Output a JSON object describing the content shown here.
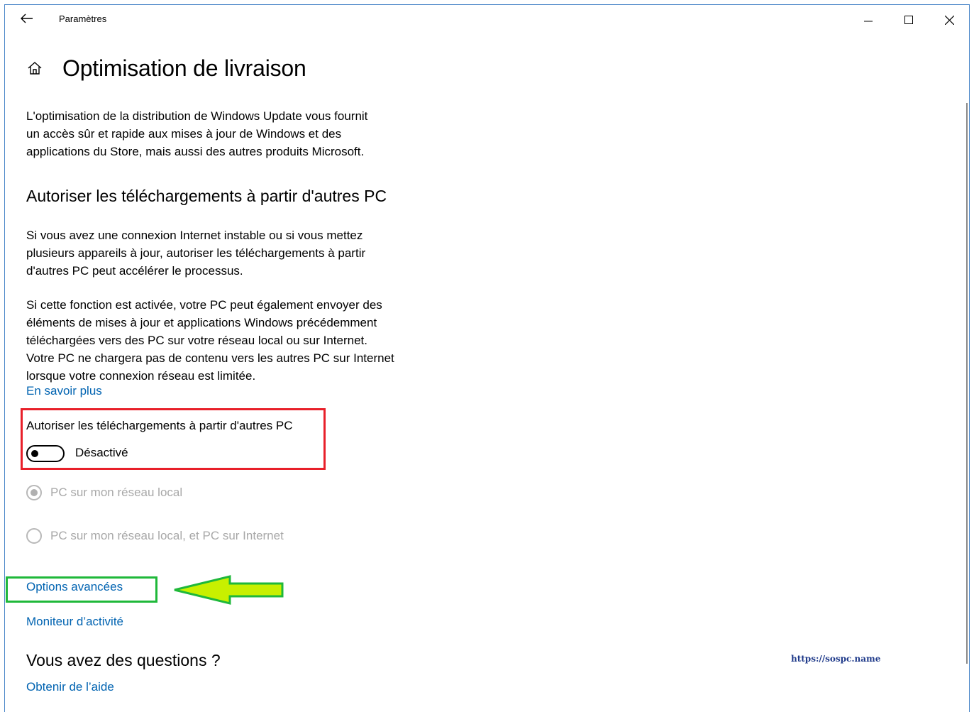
{
  "window": {
    "app_title": "Paramètres",
    "buttons": [
      "minimize-icon",
      "maximize-icon",
      "close-icon"
    ]
  },
  "page": {
    "title": "Optimisation de livraison",
    "intro_lines": [
      "L'optimisation de la distribution de Windows Update vous fournit",
      "un accès sûr et rapide aux mises à jour de Windows et des",
      "applications du Store, mais aussi des autres produits Microsoft."
    ],
    "section_heading": "Autoriser les téléchargements à partir d'autres PC",
    "para1_lines": [
      "Si vous avez une connexion Internet instable ou si vous mettez",
      "plusieurs appareils à jour, autoriser les téléchargements à partir",
      "d'autres PC peut accélérer le processus."
    ],
    "para2_lines": [
      "Si cette fonction est activée, votre PC peut également envoyer des",
      "éléments de mises à jour et applications Windows précédemment",
      "téléchargées vers des PC sur votre réseau local ou sur Internet.",
      "Votre PC ne chargera pas de contenu vers les autres PC sur Internet",
      "lorsque votre connexion réseau est limitée."
    ],
    "learn_more": "En savoir plus",
    "toggle": {
      "label": "Autoriser les téléchargements à partir d'autres PC",
      "state_text": "Désactivé",
      "on": false
    },
    "radio_options": [
      {
        "label": "PC sur mon réseau local",
        "selected": true,
        "disabled": true
      },
      {
        "label": "PC sur mon réseau local, et PC sur Internet",
        "selected": false,
        "disabled": true
      }
    ],
    "advanced_options": "Options avancées",
    "activity_monitor": "Moniteur d’activité",
    "questions_heading": "Vous avez des questions ?",
    "help_link": "Obtenir de l’aide"
  },
  "annotations": {
    "highlight_red_color": "#e8202a",
    "highlight_green_color": "#1fb83a",
    "arrow_color": "#c8f000"
  },
  "watermark": "https://sospc.name",
  "colors": {
    "link": "#0063b1",
    "disabled_text": "#a8a8a8"
  }
}
